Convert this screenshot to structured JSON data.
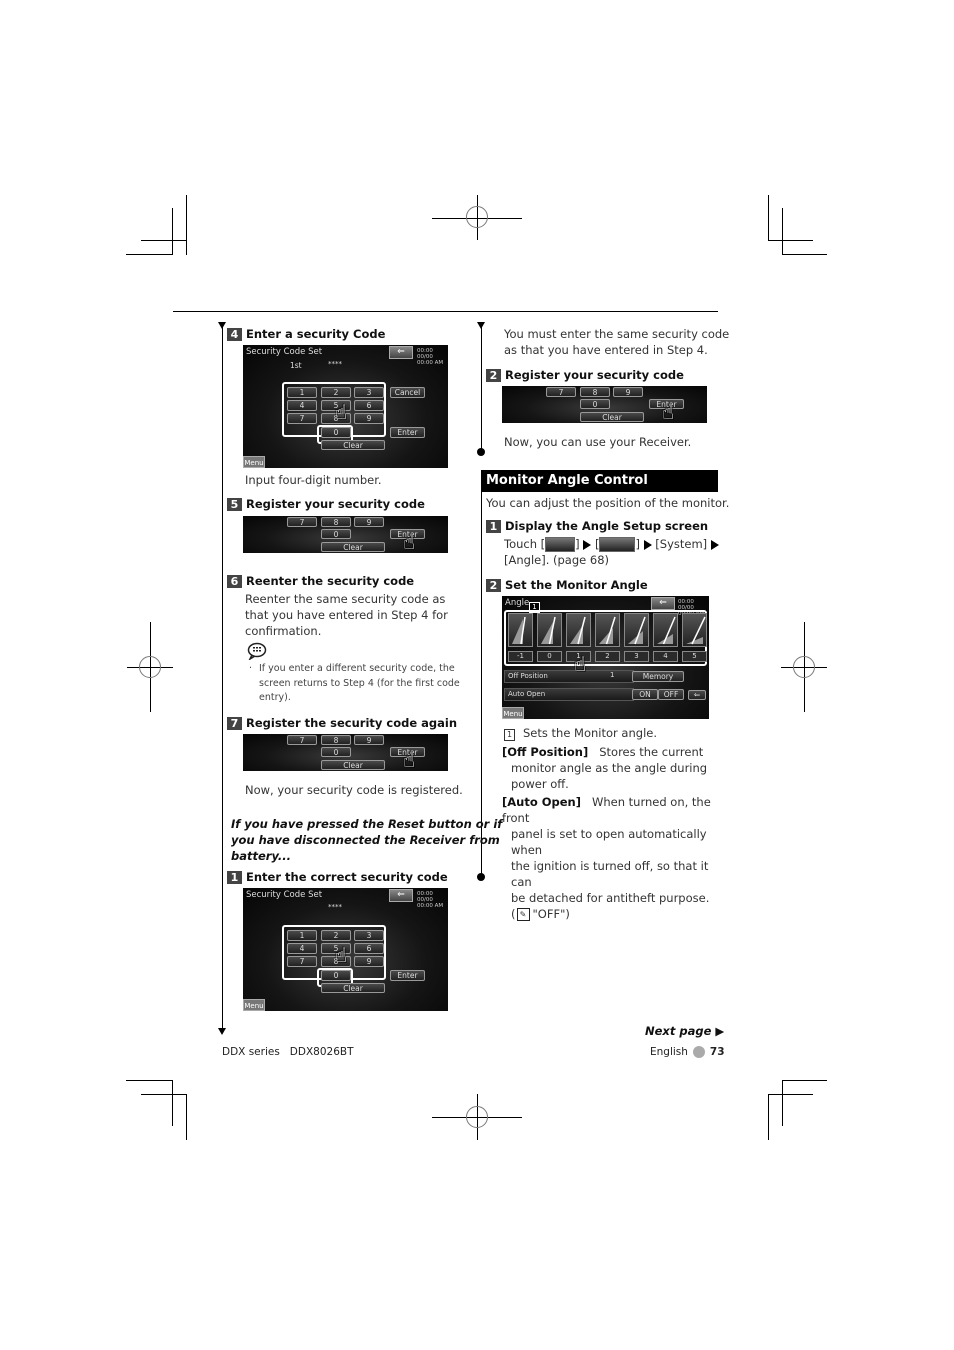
{
  "left": {
    "step4": {
      "num": "4",
      "title": "Enter a security Code",
      "caption": "Input four-digit number."
    },
    "step5": {
      "num": "5",
      "title": "Register your security code"
    },
    "step6": {
      "num": "6",
      "title": "Reenter the security code",
      "body_lines": [
        "Reenter the same security code as",
        "that you have entered in Step 4 for",
        "confirmation."
      ],
      "note_lines": [
        "If you enter a different security code, the",
        "screen returns to Step 4 (for the first code",
        "entry)."
      ]
    },
    "step7": {
      "num": "7",
      "title": "Register the security code again",
      "caption": "Now, your security code is registered."
    },
    "reset_note_lines": [
      "If you have pressed the Reset button or if",
      "you have disconnected the Receiver from",
      "battery..."
    ],
    "step1b": {
      "num": "1",
      "title": "Enter the correct security code"
    }
  },
  "right": {
    "intro_lines": [
      "You must enter the same security code",
      "as that you have entered in Step 4."
    ],
    "step2": {
      "num": "2",
      "title": "Register your security code",
      "caption": "Now, you can use your Receiver."
    },
    "section_title": "Monitor Angle Control",
    "section_intro": "You can adjust the position of the monitor.",
    "angle_step1": {
      "num": "1",
      "title": "Display the Angle Setup screen",
      "touch_label": "Touch [",
      "mid1": "]",
      "open2": "[",
      "mid2": "]",
      "system": "[System]",
      "angle_line": "[Angle]. (page 68)"
    },
    "angle_step2": {
      "num": "2",
      "title": "Set the Monitor Angle"
    },
    "callout": {
      "num": "1",
      "text": "Sets the Monitor angle."
    },
    "off_position": {
      "label": "[Off Position]",
      "lines": [
        "Stores the current",
        "monitor angle as the angle during",
        "power off."
      ]
    },
    "auto_open": {
      "label": "[Auto Open]",
      "lines": [
        "When turned on, the front",
        "panel is set to open automatically when",
        "the ignition is turned off, so that it can",
        "be detached for antitheft purpose."
      ],
      "default": "\"OFF\")",
      "default_open": "("
    }
  },
  "screens": {
    "security": {
      "title": "Security Code Set",
      "entry_label": "1st",
      "masked": "****",
      "clock_line1": "00:00 00/00",
      "clock_line2": "00:00 AM",
      "keys": [
        "1",
        "2",
        "3",
        "4",
        "5",
        "6",
        "7",
        "8",
        "9",
        "0"
      ],
      "cancel": "Cancel",
      "enter": "Enter",
      "clear": "Clear",
      "menu": "Menu",
      "back": "⇐"
    },
    "angle": {
      "title": "Angle",
      "callout": "1",
      "clock_line1": "00:00 00/00",
      "clock_line2": "00:00 AM",
      "positions": [
        "-1",
        "0",
        "1",
        "2",
        "3",
        "4",
        "5"
      ],
      "off_position_label": "Off Position",
      "off_position_value": "1",
      "memory": "Memory",
      "auto_open_label": "Auto Open",
      "on": "ON",
      "off": "OFF",
      "menu": "Menu",
      "back": "⇐"
    }
  },
  "footer": {
    "next_page": "Next page ▶",
    "model": "DDX series   DDX8026BT",
    "language": "English",
    "page": "73"
  }
}
